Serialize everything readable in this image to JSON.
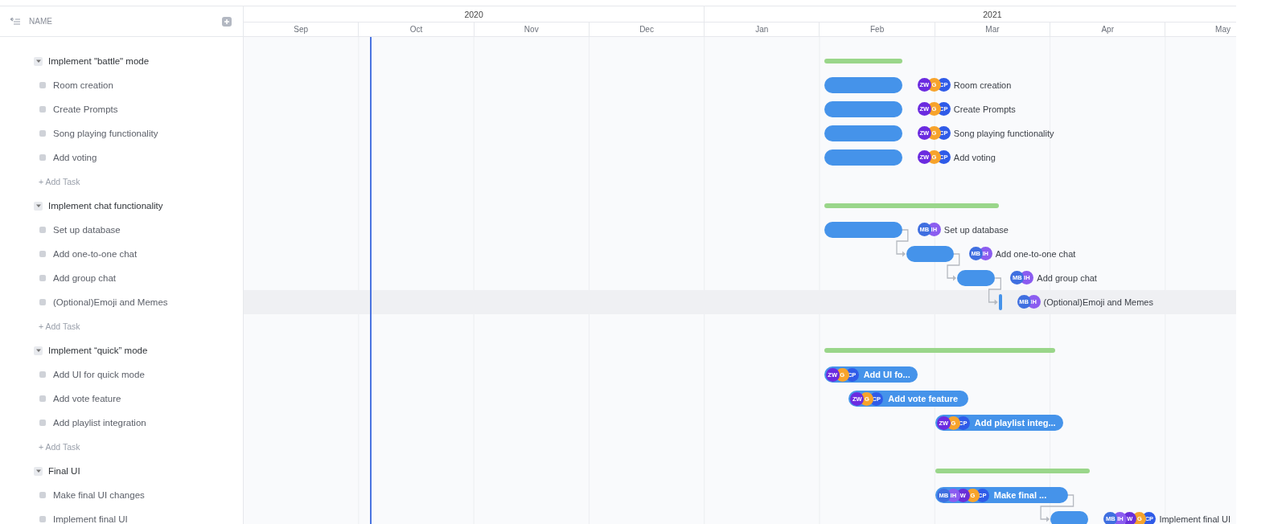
{
  "list_header": {
    "label": "NAME"
  },
  "timeline": {
    "years": [
      {
        "label": "2020",
        "months": [
          "Sep",
          "Oct",
          "Nov",
          "Dec"
        ]
      },
      {
        "label": "2021",
        "months": [
          "Jan",
          "Feb",
          "Mar",
          "Apr",
          "May"
        ]
      }
    ]
  },
  "groups": [
    {
      "name": "Implement \"battle\" mode",
      "expanded": true,
      "add_task": "+ Add Task",
      "tasks": [
        {
          "name": "Room creation",
          "highlighted": false,
          "depends_on_previous": false,
          "bar": {
            "label": "Room creation",
            "label_inside": false
          },
          "assignees": [
            {
              "initials": "ZW",
              "color": "#6b2be0"
            },
            {
              "initials": "G",
              "color": "#f7a32b"
            },
            {
              "initials": "CP",
              "color": "#2f5be8"
            }
          ]
        },
        {
          "name": "Create Prompts",
          "highlighted": false,
          "depends_on_previous": false,
          "bar": {
            "label": "Create Prompts",
            "label_inside": false
          },
          "assignees": [
            {
              "initials": "ZW",
              "color": "#6b2be0"
            },
            {
              "initials": "G",
              "color": "#f7a32b"
            },
            {
              "initials": "CP",
              "color": "#2f5be8"
            }
          ]
        },
        {
          "name": "Song playing functionality",
          "highlighted": false,
          "depends_on_previous": false,
          "bar": {
            "label": "Song playing functionality",
            "label_inside": false
          },
          "assignees": [
            {
              "initials": "ZW",
              "color": "#6b2be0"
            },
            {
              "initials": "G",
              "color": "#f7a32b"
            },
            {
              "initials": "CP",
              "color": "#2f5be8"
            }
          ]
        },
        {
          "name": "Add voting",
          "highlighted": false,
          "depends_on_previous": false,
          "bar": {
            "label": "Add voting",
            "label_inside": false
          },
          "assignees": [
            {
              "initials": "ZW",
              "color": "#6b2be0"
            },
            {
              "initials": "G",
              "color": "#f7a32b"
            },
            {
              "initials": "CP",
              "color": "#2f5be8"
            }
          ]
        }
      ]
    },
    {
      "name": "Implement chat functionality",
      "expanded": true,
      "add_task": "+ Add Task",
      "tasks": [
        {
          "name": "Set up database",
          "highlighted": false,
          "depends_on_previous": false,
          "bar": {
            "label": "Set up database",
            "label_inside": false
          },
          "assignees": [
            {
              "initials": "MB",
              "color": "#3f6fe0"
            },
            {
              "initials": "IH",
              "color": "#8b5cf0"
            }
          ]
        },
        {
          "name": "Add one-to-one chat",
          "highlighted": false,
          "depends_on_previous": true,
          "bar": {
            "label": "Add one-to-one chat",
            "label_inside": false
          },
          "assignees": [
            {
              "initials": "MB",
              "color": "#3f6fe0"
            },
            {
              "initials": "IH",
              "color": "#8b5cf0"
            }
          ]
        },
        {
          "name": "Add group chat",
          "highlighted": false,
          "depends_on_previous": true,
          "bar": {
            "label": "Add group chat",
            "label_inside": false
          },
          "assignees": [
            {
              "initials": "MB",
              "color": "#3f6fe0"
            },
            {
              "initials": "IH",
              "color": "#8b5cf0"
            }
          ]
        },
        {
          "name": "(Optional)Emoji and Memes",
          "highlighted": true,
          "depends_on_previous": true,
          "bar": {
            "label": "(Optional)Emoji and Memes",
            "label_inside": false
          },
          "assignees": [
            {
              "initials": "MB",
              "color": "#3f6fe0"
            },
            {
              "initials": "IH",
              "color": "#8b5cf0"
            }
          ]
        }
      ]
    },
    {
      "name": "Implement “quick” mode",
      "expanded": true,
      "add_task": "+ Add Task",
      "tasks": [
        {
          "name": "Add UI for quick mode",
          "highlighted": false,
          "depends_on_previous": false,
          "bar": {
            "label": "Add UI fo...",
            "label_inside": true
          },
          "assignees": [
            {
              "initials": "ZW",
              "color": "#6b2be0"
            },
            {
              "initials": "G",
              "color": "#f7a32b"
            },
            {
              "initials": "CP",
              "color": "#2f5be8"
            }
          ]
        },
        {
          "name": "Add vote feature",
          "highlighted": false,
          "depends_on_previous": false,
          "bar": {
            "label": "Add vote feature",
            "label_inside": true
          },
          "assignees": [
            {
              "initials": "ZW",
              "color": "#6b2be0"
            },
            {
              "initials": "G",
              "color": "#f7a32b"
            },
            {
              "initials": "CP",
              "color": "#2f5be8"
            }
          ]
        },
        {
          "name": "Add playlist integration",
          "highlighted": false,
          "depends_on_previous": false,
          "bar": {
            "label": "Add playlist integ...",
            "label_inside": true
          },
          "assignees": [
            {
              "initials": "ZW",
              "color": "#6b2be0"
            },
            {
              "initials": "G",
              "color": "#f7a32b"
            },
            {
              "initials": "CP",
              "color": "#2f5be8"
            }
          ]
        }
      ]
    },
    {
      "name": "Final UI",
      "expanded": true,
      "tasks": [
        {
          "name": "Make final UI changes",
          "highlighted": false,
          "depends_on_previous": false,
          "bar": {
            "label": "Make final ...",
            "label_inside": true
          },
          "assignees": [
            {
              "initials": "MB",
              "color": "#3f6fe0"
            },
            {
              "initials": "IH",
              "color": "#8b5cf0"
            },
            {
              "initials": "W",
              "color": "#6a2fd8"
            },
            {
              "initials": "G",
              "color": "#f7a32b"
            },
            {
              "initials": "CP",
              "color": "#2f5be8"
            }
          ]
        },
        {
          "name": "Implement final UI",
          "highlighted": false,
          "depends_on_previous": true,
          "bar": {
            "label": "Implement final UI",
            "label_inside": false
          },
          "assignees": [
            {
              "initials": "MB",
              "color": "#3f6fe0"
            },
            {
              "initials": "IH",
              "color": "#8b5cf0"
            },
            {
              "initials": "W",
              "color": "#6a2fd8"
            },
            {
              "initials": "G",
              "color": "#f7a32b"
            },
            {
              "initials": "CP",
              "color": "#2f5be8"
            }
          ]
        }
      ]
    }
  ]
}
